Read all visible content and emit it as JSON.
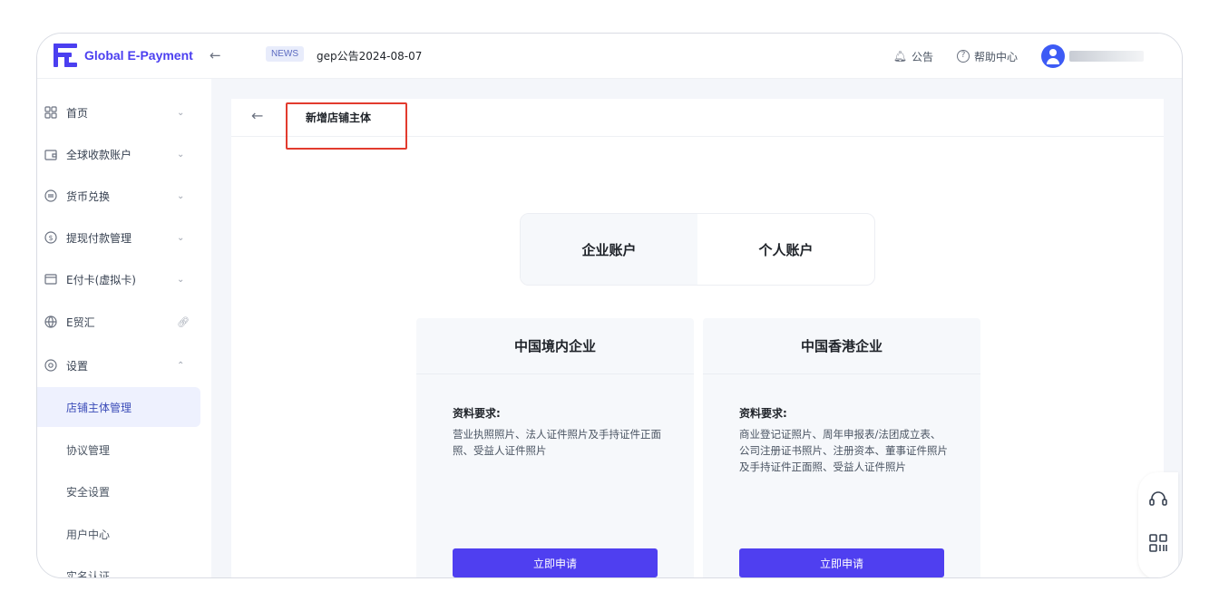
{
  "app": {
    "logo_text": "Global E-Payment",
    "collapse_icon": "arrow-left-icon"
  },
  "header": {
    "news_badge": "NEWS",
    "news_text": "gep公告2024-08-07",
    "announcement_label": "公告",
    "help_label": "帮助中心"
  },
  "sidebar": {
    "items": [
      {
        "label": "首页",
        "icon": "grid-icon",
        "caret": "⌄"
      },
      {
        "label": "全球收款账户",
        "icon": "wallet-icon",
        "caret": "⌄"
      },
      {
        "label": "货币兑换",
        "icon": "exchange-icon",
        "caret": "⌄"
      },
      {
        "label": "提现付款管理",
        "icon": "dollar-icon",
        "caret": "⌄"
      },
      {
        "label": "E付卡(虚拟卡)",
        "icon": "card-icon",
        "caret": "⌄"
      },
      {
        "label": "E贸汇",
        "icon": "globe-icon",
        "caret": "link-icon"
      },
      {
        "label": "设置",
        "icon": "settings-icon",
        "caret": "⌃"
      }
    ],
    "sub_items": [
      {
        "label": "店铺主体管理",
        "active": true
      },
      {
        "label": "协议管理"
      },
      {
        "label": "安全设置"
      },
      {
        "label": "用户中心"
      },
      {
        "label": "实名认证"
      }
    ]
  },
  "page": {
    "title": "新增店铺主体",
    "tabs": [
      {
        "label": "企业账户",
        "selected": true
      },
      {
        "label": "个人账户"
      }
    ],
    "cards": [
      {
        "title": "中国境内企业",
        "req_label": "资料要求:",
        "req_text": "营业执照照片、法人证件照片及手持证件正面照、受益人证件照片",
        "button": "立即申请"
      },
      {
        "title": "中国香港企业",
        "req_label": "资料要求:",
        "req_text": "商业登记证照片、周年申报表/法团成立表、公司注册证书照片、注册资本、董事证件照片及手持证件正面照、受益人证件照片",
        "button": "立即申请"
      }
    ]
  },
  "colors": {
    "accent": "#4f3ff0",
    "highlight": "#e23b2e"
  }
}
